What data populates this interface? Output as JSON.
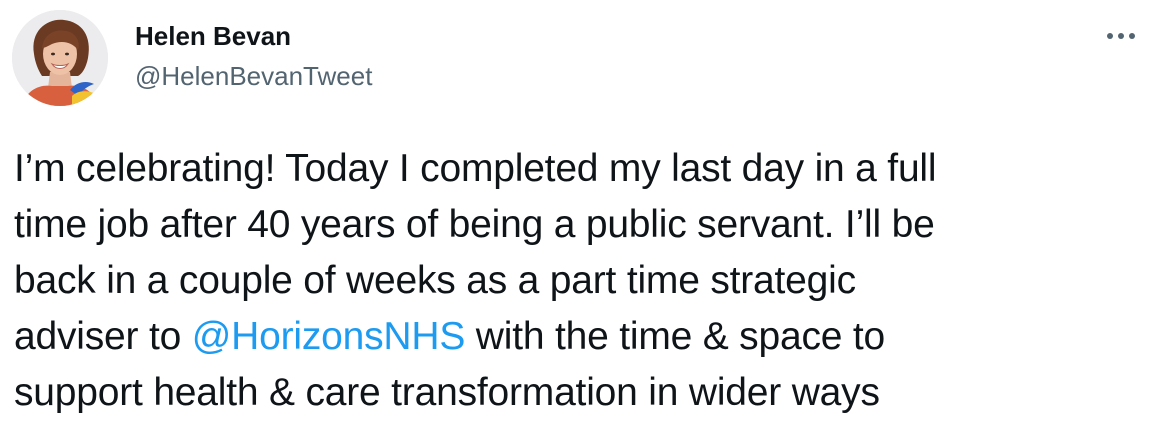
{
  "tweet": {
    "author": {
      "display_name": "Helen Bevan",
      "handle": "@HelenBevanTweet"
    },
    "more_icon": "more-horizontal-icon",
    "text_lines": {
      "line1": "I’m celebrating! Today I completed my last day in a full",
      "line2": "time job after 40 years of being a public servant. I’ll be",
      "line3": "back in a couple of weeks as a part time strategic",
      "line4_before": "adviser to ",
      "line4_mention": "@HorizonsNHS",
      "line4_after": " with the time & space to",
      "line5": "support health & care transformation in wider ways"
    },
    "colors": {
      "text": "#0f1419",
      "secondary": "#536471",
      "link": "#1d9bf0"
    }
  }
}
